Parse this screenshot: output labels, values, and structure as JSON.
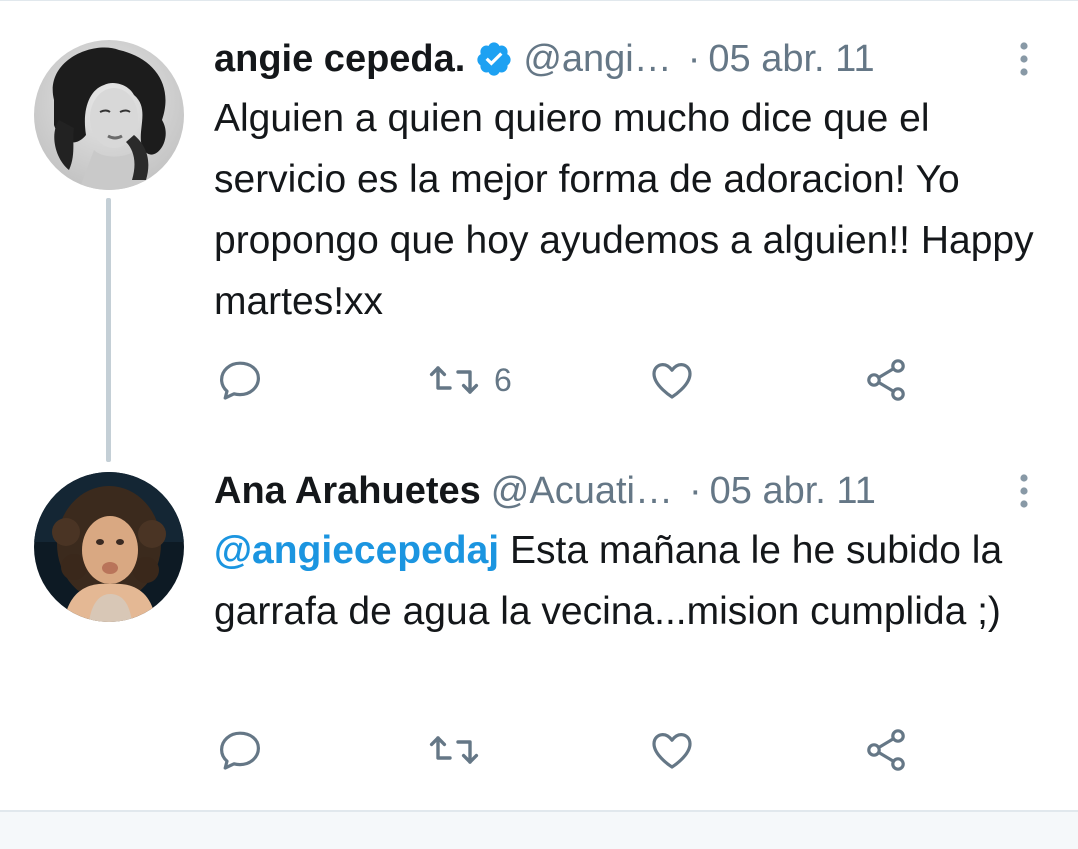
{
  "colors": {
    "text": "#14171a",
    "secondary": "#657786",
    "link": "#1b95e0",
    "verified": "#1da1f2",
    "thread_line": "#c4cfd6"
  },
  "tweets": [
    {
      "display_name": "angie cepeda.",
      "verified": true,
      "handle": "@angi…",
      "separator": "·",
      "date": "05 abr. 11",
      "mention": "",
      "text": "Alguien a quien quiero mucho dice que el servicio es la mejor forma de adoracion! Yo propongo que hoy ayudemos a alguien!! Happy martes!xx",
      "retweet_count": "6",
      "icons": [
        "reply-icon",
        "retweet-icon",
        "like-icon",
        "share-icon",
        "more-icon"
      ]
    },
    {
      "display_name": "Ana Arahuetes",
      "verified": false,
      "handle": "@Acuati…",
      "separator": "·",
      "date": "05 abr. 11",
      "mention": "@angiecepedaj",
      "text": " Esta mañana le he subido la garrafa de agua la vecina...mision cumplida ;)",
      "retweet_count": "",
      "icons": [
        "reply-icon",
        "retweet-icon",
        "like-icon",
        "share-icon",
        "more-icon"
      ]
    }
  ]
}
